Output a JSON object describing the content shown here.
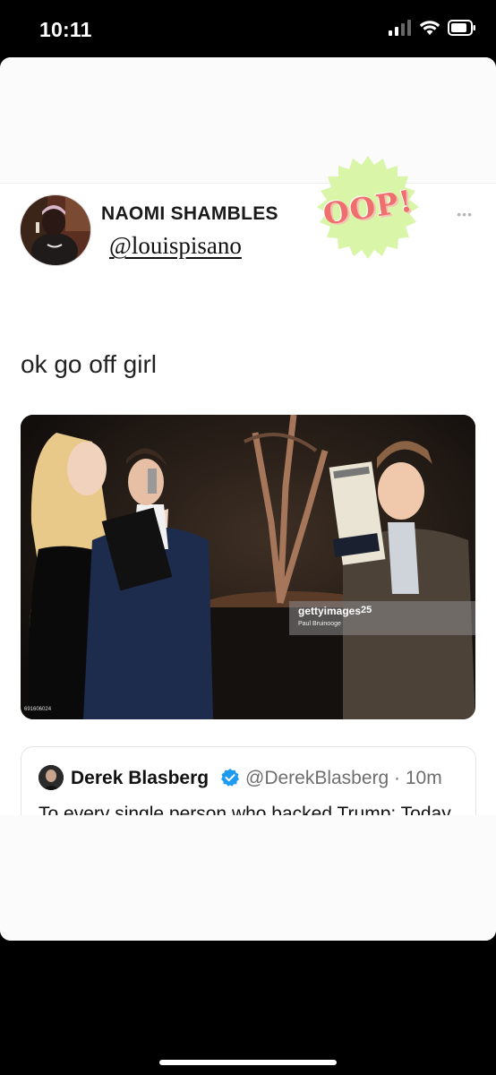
{
  "status_bar": {
    "time": "10:11"
  },
  "tweet": {
    "author_name": "NAOMI SHAMBLES",
    "author_handle": "@louispisano",
    "text": "ok go off girl",
    "more_icon": "•••"
  },
  "sticker": {
    "text": "OOP!",
    "color": "#d9f5a8"
  },
  "photo": {
    "getty_logo": "gettyimages",
    "getty_badge": "25",
    "getty_credit": "Paul Bruinooge",
    "image_id": "691606024"
  },
  "quoted_tweet": {
    "name": "Derek Blasberg",
    "handle": "@DerekBlasberg · 10m",
    "text": "To every single person who backed Trump: Today is your shame.",
    "verified_color": "#1d9bf0"
  }
}
